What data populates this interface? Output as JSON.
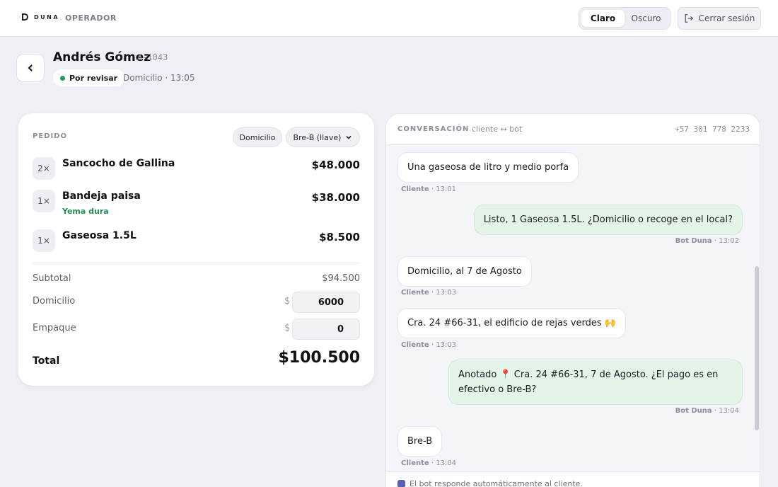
{
  "brand": {
    "name": "DUNA",
    "role": "OPERADOR"
  },
  "theme": {
    "light_label": "Claro",
    "dark_label": "Oscuro",
    "selected": "Claro"
  },
  "logout_label": "Cerrar sesión",
  "header": {
    "customer_name": "Andrés Gómez",
    "order_code": "A-1043",
    "status": "Por revisar",
    "meta": "Domicilio · 13:05"
  },
  "order": {
    "label": "PEDIDO",
    "delivery_type": "Domicilio",
    "payment_method": "Bre-B (llave)",
    "items": [
      {
        "qty": "2×",
        "name": "Sancocho de Gallina",
        "price": "$48.000",
        "note": ""
      },
      {
        "qty": "1×",
        "name": "Bandeja paisa",
        "price": "$38.000",
        "note": "Yema dura"
      },
      {
        "qty": "1×",
        "name": "Gaseosa 1.5L",
        "price": "$8.500",
        "note": ""
      }
    ],
    "subtotal_label": "Subtotal",
    "subtotal_value": "$94.500",
    "delivery_label": "Domicilio",
    "delivery_value": "6000",
    "packaging_label": "Empaque",
    "packaging_value": "0",
    "currency_symbol": "$",
    "total_label": "Total",
    "total_value": "$100.500"
  },
  "chat": {
    "title": "CONVERSACIÓN",
    "subtitle": "cliente ↔ bot",
    "phone": "+57 301 778 2233",
    "messages": [
      {
        "from": "client",
        "text": "Una gaseosa de litro y medio porfa",
        "author": "Cliente",
        "time": "13:01"
      },
      {
        "from": "bot",
        "text": "Listo, 1 Gaseosa 1.5L. ¿Domicilio o recoge en el local?",
        "author": "Bot Duna",
        "time": "13:02"
      },
      {
        "from": "client",
        "text": "Domicilio, al 7 de Agosto",
        "author": "Cliente",
        "time": "13:03"
      },
      {
        "from": "client",
        "text": "Cra. 24 #66-31, el edificio de rejas verdes 🙌",
        "author": "Cliente",
        "time": "13:03"
      },
      {
        "from": "bot",
        "text": "Anotado 📍 Cra. 24 #66-31, 7 de Agosto. ¿El pago es en efectivo o Bre-B?",
        "author": "Bot Duna",
        "time": "13:04"
      },
      {
        "from": "client",
        "text": "Bre-B",
        "author": "Cliente",
        "time": "13:04"
      }
    ],
    "footer_note": "El bot responde automáticamente al cliente."
  },
  "colors": {
    "accent_green": "#1b9d5b",
    "bot_bubble": "#e4f4e9",
    "background": "#eef0f6"
  },
  "icons": {
    "back": "chevron-left-icon",
    "logout": "logout-icon",
    "dropdown": "chevron-down-icon"
  }
}
